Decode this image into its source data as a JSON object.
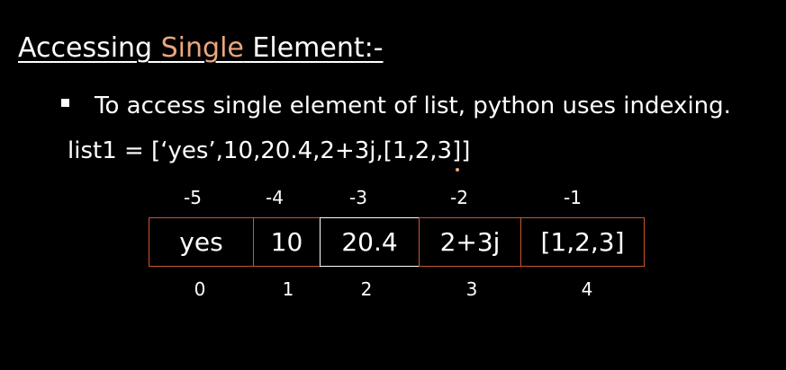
{
  "title": {
    "prefix": "Accessing ",
    "accent": "Single",
    "suffix": " Element:-",
    "accent_color": "#e8a77e"
  },
  "bullet": {
    "text": "To access single element of list, python uses indexing."
  },
  "code": {
    "line": "list1 = [‘yes’,10,20.4,2+3j,[1,2,3]]"
  },
  "list_table": {
    "cells": [
      "yes",
      "10",
      "20.4",
      "2+3j",
      "[1,2,3]"
    ],
    "negative_indices": [
      "-5",
      "-4",
      "-3",
      "-2",
      "-1"
    ],
    "positive_indices": [
      "0",
      "1",
      "2",
      "3",
      "4"
    ],
    "border_color": "#c9572e"
  }
}
